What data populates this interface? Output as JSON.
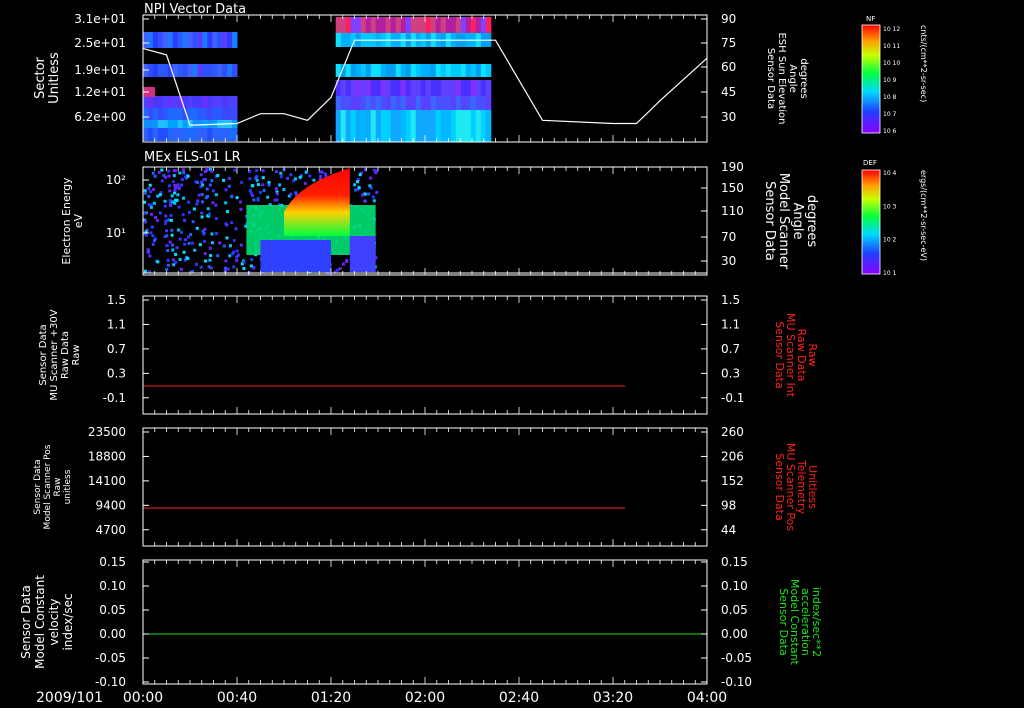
{
  "colors": {
    "background": "#000000",
    "frame": "#ffffff",
    "red": "#ff2020",
    "green": "#20e020"
  },
  "time_axis": {
    "date": "2009/101",
    "ticks": [
      "00:00",
      "00:40",
      "01:20",
      "02:00",
      "02:40",
      "03:20",
      "04:00"
    ]
  },
  "colorbars": [
    {
      "label": "NF",
      "unit": "cnts/(cm**2-sr-sec)",
      "ticks": [
        "10^12",
        "10^11",
        "10^10",
        "10^9",
        "10^8",
        "10^7",
        "10^6"
      ]
    },
    {
      "label": "DEF",
      "unit": "ergs/(cm**2-sr-sec-eV)",
      "ticks": [
        "10^4",
        "10^3",
        "10^2",
        "10^1"
      ]
    }
  ],
  "chart_data": [
    {
      "type": "heatmap",
      "title": "NPI Vector Data",
      "ylabel": [
        "Sector",
        "Unitless"
      ],
      "yticks": [
        "3.1e+01",
        "2.5e+01",
        "1.9e+01",
        "1.2e+01",
        "6.2e+00"
      ],
      "right_label": [
        "Sensor Data",
        "ESH Sun Elevation",
        "Angle",
        "degrees"
      ],
      "right_ticks": [
        "90",
        "75",
        "60",
        "45",
        "30"
      ],
      "segments": [
        {
          "start": "00:00",
          "end": "00:40"
        },
        {
          "start": "01:22",
          "end": "02:28"
        }
      ],
      "line": {
        "name": "ESH Sun Elevation",
        "x": [
          "00:00",
          "00:10",
          "00:20",
          "00:40",
          "00:50",
          "01:00",
          "01:10",
          "01:20",
          "01:30",
          "02:00",
          "02:30",
          "02:50",
          "03:20",
          "03:30",
          "03:40",
          "04:00"
        ],
        "y": [
          72,
          68,
          25,
          26,
          32,
          32,
          28,
          42,
          77,
          77,
          77,
          28,
          26,
          26,
          40,
          66
        ]
      }
    },
    {
      "type": "heatmap",
      "title": "MEx ELS-01 LR",
      "ylabel": [
        "Electron Energy",
        "eV"
      ],
      "yticks": [
        "10^2",
        "10^1"
      ],
      "right_label": [
        "Sensor Data",
        "Model Scanner",
        "Angle",
        "degrees"
      ],
      "right_ticks": [
        "190",
        "150",
        "110",
        "70",
        "30"
      ],
      "segments": [
        {
          "start": "00:00",
          "end": "01:39"
        }
      ],
      "line": {
        "name": "Model Scanner Angle",
        "x": [
          "00:00",
          "04:00"
        ],
        "y": [
          10,
          10
        ]
      }
    },
    {
      "type": "line",
      "ylabel": [
        "Sensor Data",
        "MU Scanner +30V",
        "Raw Data",
        "Raw"
      ],
      "yticks": [
        "1.5",
        "1.1",
        "0.7",
        "0.3",
        "-0.1"
      ],
      "right_label": [
        "Sensor Data",
        "MU Scanner Int",
        "Raw Data",
        "Raw"
      ],
      "right_ticks": [
        "1.5",
        "1.1",
        "0.7",
        "0.3",
        "-0.1"
      ],
      "ylim": [
        -0.3,
        1.5
      ],
      "series": [
        {
          "color": "#ff2020",
          "x": [
            "00:00",
            "03:25"
          ],
          "y": [
            0,
            0
          ]
        }
      ]
    },
    {
      "type": "line",
      "ylabel": [
        "Sensor Data",
        "Model Scanner Pos",
        "Raw",
        "unitless"
      ],
      "yticks": [
        "23500",
        "18800",
        "14100",
        "9400",
        "4700"
      ],
      "right_label": [
        "Sensor Data",
        "MU Scanner Pos",
        "Telemetry",
        "Unitless"
      ],
      "right_ticks": [
        "260",
        "206",
        "152",
        "98",
        "44"
      ],
      "ylim": [
        0,
        23500
      ],
      "series": [
        {
          "color": "#ff2020",
          "x": [
            "00:00",
            "03:25"
          ],
          "y": [
            8800,
            8800
          ]
        }
      ]
    },
    {
      "type": "line",
      "ylabel": [
        "Sensor Data",
        "Model Constant",
        "velocity",
        "index/sec"
      ],
      "yticks": [
        "0.15",
        "0.10",
        "0.05",
        "0.00",
        "-0.05",
        "-0.10"
      ],
      "right_label": [
        "Sensor Data",
        "Model Constant",
        "acceleration",
        "index/sec**2"
      ],
      "right_ticks": [
        "0.15",
        "0.10",
        "0.05",
        "0.00",
        "-0.05",
        "-0.10"
      ],
      "ylim": [
        -0.1,
        0.15
      ],
      "series": [
        {
          "color": "#20e020",
          "x": [
            "00:00",
            "04:00"
          ],
          "y": [
            0,
            0
          ]
        }
      ]
    }
  ]
}
